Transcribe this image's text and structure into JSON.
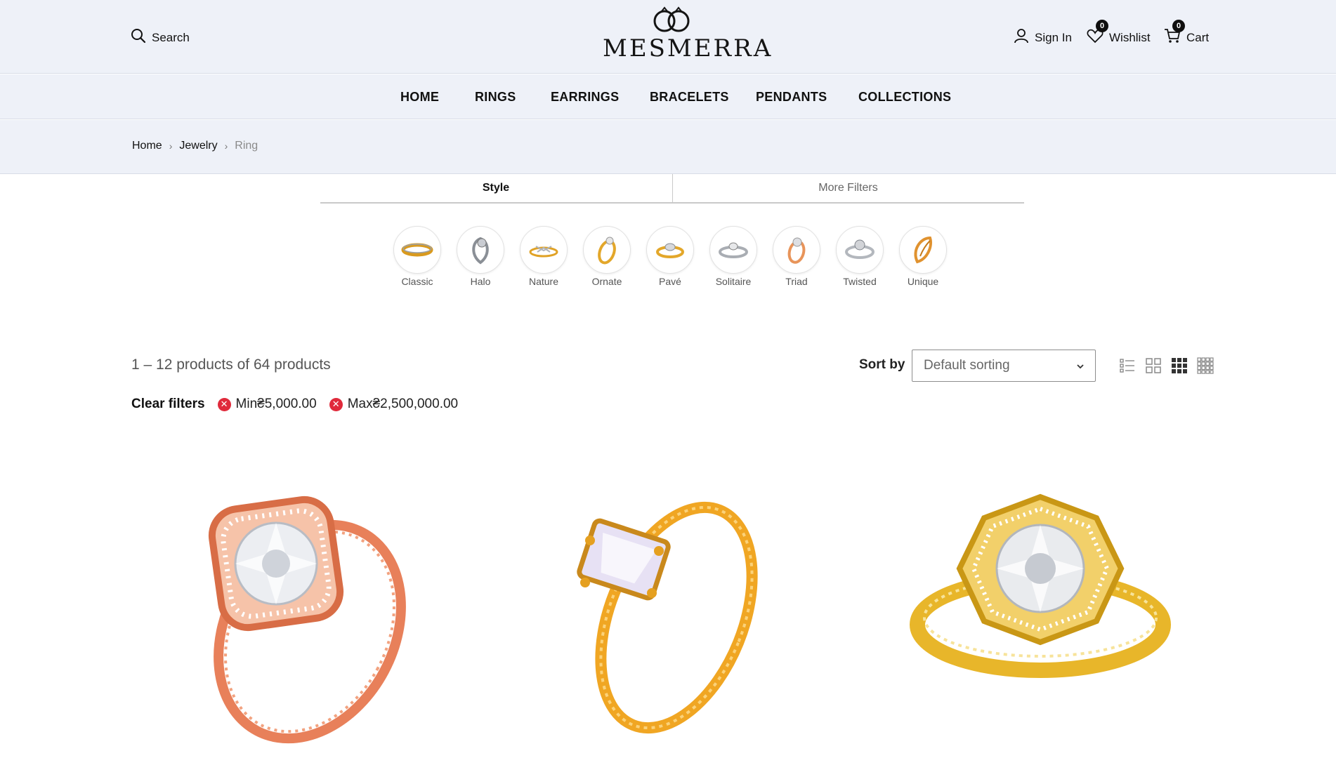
{
  "header": {
    "search_label": "Search",
    "logo_text": "MESMERRA",
    "signin_label": "Sign In",
    "wishlist_label": "Wishlist",
    "wishlist_count": "0",
    "cart_label": "Cart",
    "cart_count": "0"
  },
  "nav": [
    "HOME",
    "RINGS",
    "EARRINGS",
    "BRACELETS",
    "PENDANTS",
    "COLLECTIONS"
  ],
  "breadcrumb": {
    "home": "Home",
    "sep": "›",
    "jewelry": "Jewelry",
    "current": "Ring"
  },
  "tabs": {
    "style": "Style",
    "more": "More Filters"
  },
  "styles": [
    "Classic",
    "Halo",
    "Nature",
    "Ornate",
    "Pavé",
    "Solitaire",
    "Triad",
    "Twisted",
    "Unique"
  ],
  "toolbar": {
    "result_count": "1 – 12 products of 64 products",
    "sort_label": "Sort by",
    "sort_value": "Default sorting"
  },
  "filters": {
    "clear_label": "Clear filters",
    "min_label": "Min₴5,000.00",
    "max_label": "Max₴2,500,000.00"
  },
  "colors": {
    "header_bg": "#eef1f8",
    "rose_gold": "#e8805a",
    "yellow_gold": "#f0a623",
    "remove_red": "#e02a3b"
  }
}
